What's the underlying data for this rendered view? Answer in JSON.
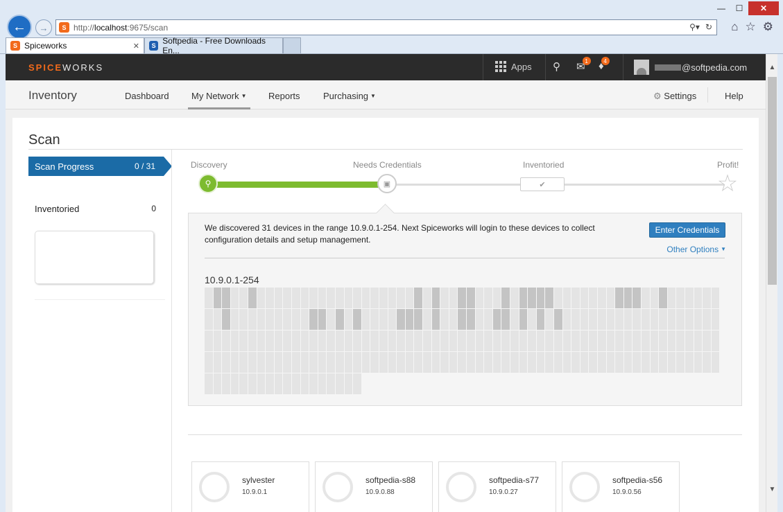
{
  "browser": {
    "window_controls": {
      "minimize": "—",
      "maximize": "☐",
      "close": "✕"
    },
    "address": {
      "prefix": "http://",
      "host": "localhost",
      "rest": ":9675/scan"
    },
    "tabs": [
      {
        "label": "Spiceworks",
        "icon": "spiceworks-favicon",
        "close": "✕"
      },
      {
        "label": "Softpedia - Free Downloads En...",
        "icon": "softpedia-favicon"
      }
    ],
    "icons": [
      "search-icon",
      "refresh-icon",
      "home-icon",
      "favorites-star-icon",
      "settings-gear-icon"
    ]
  },
  "app": {
    "logo": {
      "part1": "SPICE",
      "part2": "WORKS"
    },
    "apps_label": "Apps",
    "messages_badge": "1",
    "notifications_badge": "4",
    "user_email": "@softpedia.com",
    "colors": {
      "brand": "#f26a1b",
      "primary": "#1b6ba6",
      "success": "#7dbb2f"
    }
  },
  "nav": {
    "title": "Inventory",
    "items": [
      {
        "label": "Dashboard"
      },
      {
        "label": "My Network",
        "dropdown": true,
        "selected": true
      },
      {
        "label": "Reports"
      },
      {
        "label": "Purchasing",
        "dropdown": true
      }
    ],
    "settings": "Settings",
    "help": "Help"
  },
  "scan": {
    "title": "Scan",
    "sidebar": {
      "progress_label": "Scan Progress",
      "progress_value": "0 / 31",
      "inventoried_label": "Inventoried",
      "inventoried_value": "0"
    },
    "steps": [
      {
        "label": "Discovery",
        "state": "done"
      },
      {
        "label": "Needs Credentials",
        "state": "current"
      },
      {
        "label": "Inventoried",
        "state": "pending"
      },
      {
        "label": "Profit!",
        "state": "pending"
      }
    ],
    "message": "We discovered 31 devices in the range 10.9.0.1-254. Next Spiceworks will login to these devices to collect configuration details and setup management.",
    "enter_credentials": "Enter Credentials",
    "other_options": "Other Options",
    "range_label": "10.9.0.1-254",
    "grid": {
      "columns": 59,
      "total_cells": 254,
      "discovered_cells": [
        1,
        2,
        5,
        24,
        26,
        29,
        30,
        34,
        36,
        37,
        38,
        39,
        47,
        48,
        49,
        52,
        61,
        71,
        72,
        74,
        76,
        81,
        82,
        83,
        85,
        88,
        89,
        92,
        93,
        95,
        97,
        99
      ]
    },
    "devices": [
      {
        "name": "sylvester",
        "ip": "10.9.0.1"
      },
      {
        "name": "softpedia-s88",
        "ip": "10.9.0.88"
      },
      {
        "name": "softpedia-s77",
        "ip": "10.9.0.27"
      },
      {
        "name": "softpedia-s56",
        "ip": "10.9.0.56"
      }
    ]
  }
}
